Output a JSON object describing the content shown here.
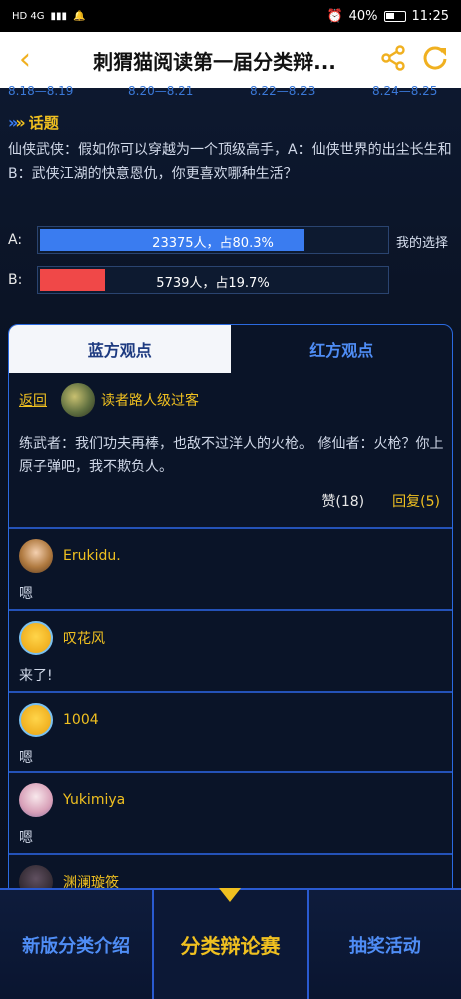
{
  "status_bar": {
    "left": "HD 4G",
    "battery": "40%",
    "time": "11:25"
  },
  "header": {
    "title": "刺猬猫阅读第一届分类辩...",
    "back_icon": "chevron-left-icon",
    "share_icon": "share-icon",
    "refresh_icon": "refresh-icon",
    "accent": "#f0b020"
  },
  "timeline": [
    "8.18—8.19",
    "8.20—8.21",
    "8.22—8.23",
    "8.24—8.25"
  ],
  "topic": {
    "label": "话题",
    "text": "仙侠武侠：假如你可以穿越为一个顶级高手，A：仙侠世界的出尘长生和 B：武侠江湖的快意恩仇，你更喜欢哪种生活？"
  },
  "votes": [
    {
      "option": "A:",
      "text": "23375人，占80.3%",
      "percent": 80.3,
      "color": "#3a7cf0",
      "mine": "我的选择"
    },
    {
      "option": "B:",
      "text": "5739人，占19.7%",
      "percent": 19.7,
      "color": "#f04848",
      "mine": ""
    }
  ],
  "tabs": {
    "blue": "蓝方观点",
    "red": "红方观点"
  },
  "thread": {
    "back": "返回",
    "author": "读者路人级过客",
    "content": "练武者：我们功夫再棒，也敌不过洋人的火枪。 修仙者：火枪？你上原子弹吧，我不欺负人。",
    "likes": "赞(18)",
    "replies": "回复(5)"
  },
  "comments": [
    {
      "name": "Erukidu.",
      "body": "嗯",
      "avatar": "av-girl"
    },
    {
      "name": "叹花风",
      "body": "来了!",
      "avatar": "av-emoji"
    },
    {
      "name": "1004",
      "body": "嗯",
      "avatar": "av-emoji"
    },
    {
      "name": "Yukimiya",
      "body": "嗯",
      "avatar": "av-pink"
    },
    {
      "name": "渊澜璇筱",
      "body": "",
      "avatar": "av-dark"
    }
  ],
  "bottom_nav": {
    "left": "新版分类介绍",
    "center": "分类辩论赛",
    "right": "抽奖活动"
  }
}
